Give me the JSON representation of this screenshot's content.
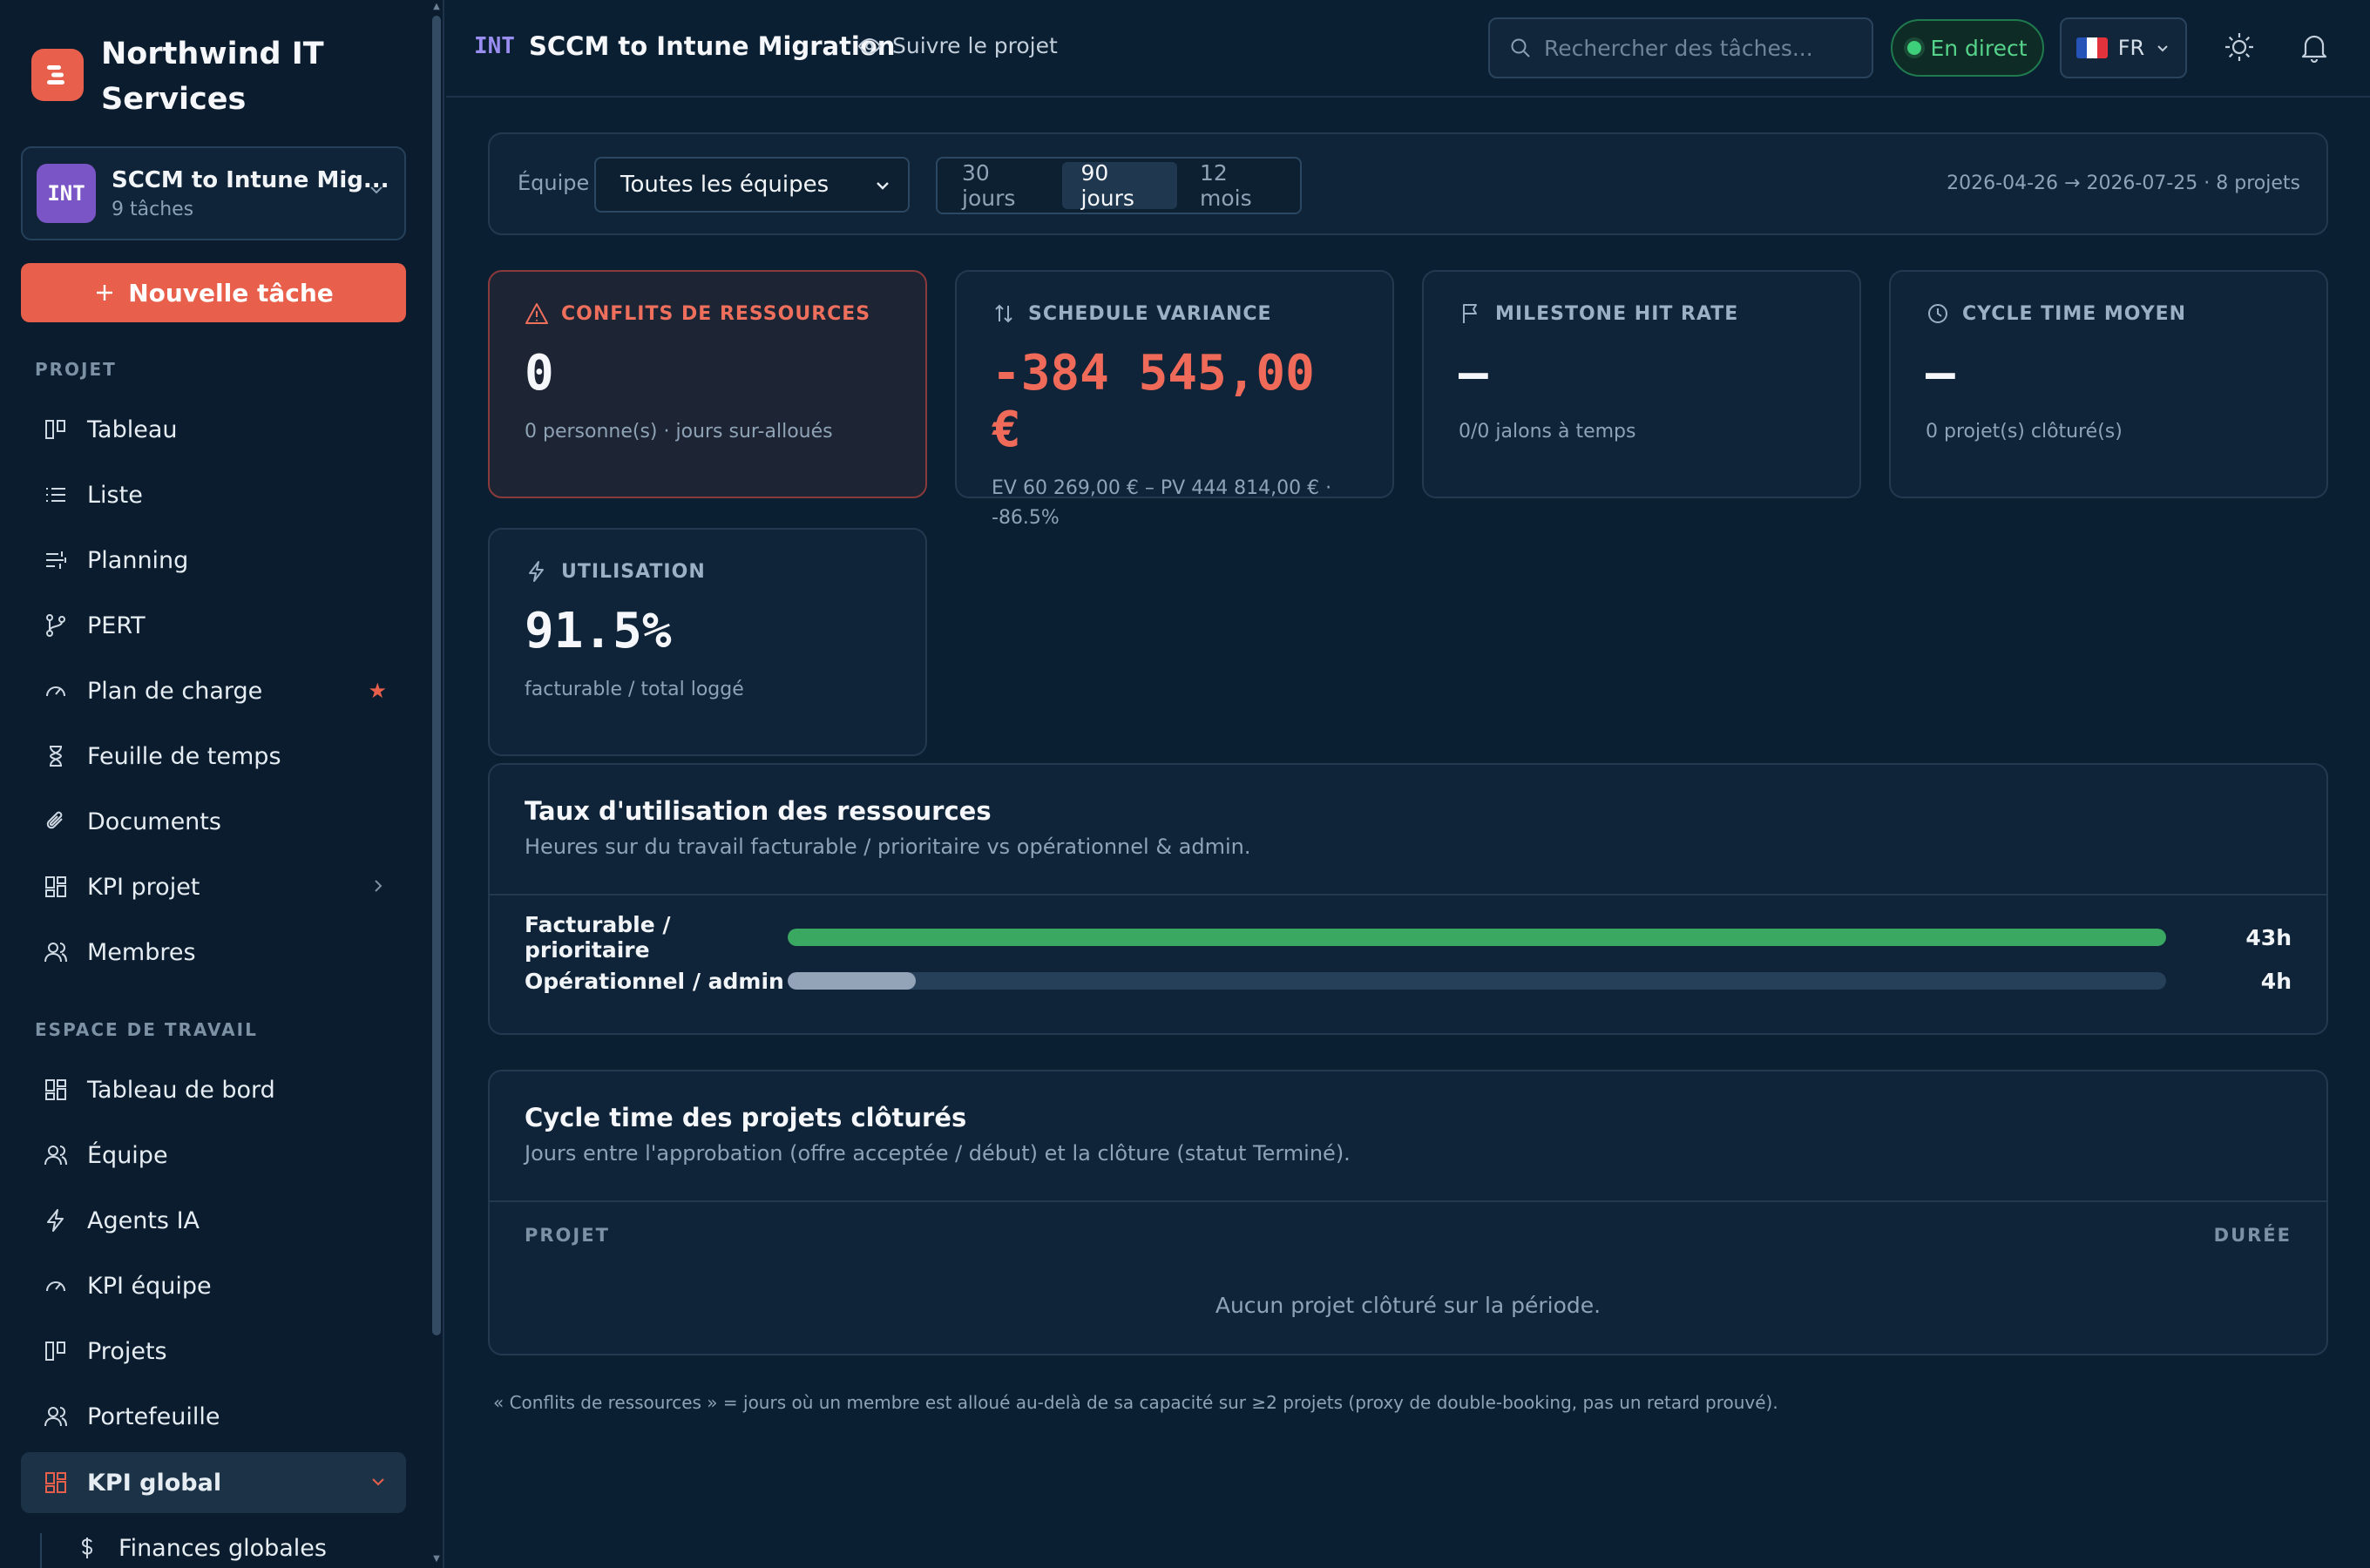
{
  "brand": {
    "name": "Northwind IT Services"
  },
  "project_selector": {
    "code": "INT",
    "name": "SCCM to Intune Mig...",
    "tasks": "9 tâches"
  },
  "new_task_label": "Nouvelle tâche",
  "sidebar": {
    "project_section": "PROJET",
    "project_items": [
      {
        "label": "Tableau",
        "icon": "kanban-icon"
      },
      {
        "label": "Liste",
        "icon": "list-icon"
      },
      {
        "label": "Planning",
        "icon": "gantt-icon"
      },
      {
        "label": "PERT",
        "icon": "branch-icon"
      },
      {
        "label": "Plan de charge",
        "icon": "gauge-icon",
        "starred": true
      },
      {
        "label": "Feuille de temps",
        "icon": "hourglass-icon"
      },
      {
        "label": "Documents",
        "icon": "paperclip-icon"
      },
      {
        "label": "KPI projet",
        "icon": "grid-icon",
        "has_submenu": true
      },
      {
        "label": "Membres",
        "icon": "users-icon"
      }
    ],
    "workspace_section": "ESPACE DE TRAVAIL",
    "workspace_items": [
      {
        "label": "Tableau de bord",
        "icon": "grid-icon"
      },
      {
        "label": "Équipe",
        "icon": "users-icon"
      },
      {
        "label": "Agents IA",
        "icon": "bolt-icon"
      },
      {
        "label": "KPI équipe",
        "icon": "gauge-icon"
      },
      {
        "label": "Projets",
        "icon": "kanban-icon"
      },
      {
        "label": "Portefeuille",
        "icon": "users-icon"
      },
      {
        "label": "KPI global",
        "icon": "grid-icon",
        "active": true
      },
      {
        "label": "Finances globales",
        "icon": "dollar-icon",
        "sub": true
      }
    ]
  },
  "topbar": {
    "code": "INT",
    "title": "SCCM to Intune Migration",
    "follow": "Suivre le projet",
    "search_placeholder": "Rechercher des tâches...",
    "live": "En direct",
    "lang": "FR"
  },
  "filters": {
    "team_label": "Équipe",
    "team_value": "Toutes les équipes",
    "periods": [
      "30 jours",
      "90 jours",
      "12 mois"
    ],
    "selected_period": "90 jours",
    "range": "2026-04-26 → 2026-07-25 · 8 projets"
  },
  "kpis": [
    {
      "title": "CONFLITS DE RESSOURCES",
      "value": "0",
      "sub": "0 personne(s) · jours sur-alloués",
      "icon": "warning-icon"
    },
    {
      "title": "SCHEDULE VARIANCE",
      "value": "-384 545,00 €",
      "sub": "EV 60 269,00 € – PV 444 814,00 € · -86.5%",
      "icon": "sort-icon"
    },
    {
      "title": "MILESTONE HIT RATE",
      "value": "—",
      "sub": "0/0 jalons à temps",
      "icon": "flag-icon"
    },
    {
      "title": "CYCLE TIME MOYEN",
      "value": "—",
      "sub": "0 projet(s) clôturé(s)",
      "icon": "clock-icon"
    },
    {
      "title": "UTILISATION",
      "value": "91.5%",
      "sub": "facturable / total loggé",
      "icon": "bolt-icon"
    }
  ],
  "utilization": {
    "title": "Taux d'utilisation des ressources",
    "subtitle": "Heures sur du travail facturable / prioritaire vs opérationnel & admin.",
    "rows": [
      {
        "label": "Facturable / prioritaire",
        "value": "43h",
        "hours": 43,
        "color": "#3aa860"
      },
      {
        "label": "Opérationnel / admin",
        "value": "4h",
        "hours": 4,
        "color": "#93a3b8"
      }
    ]
  },
  "cycle": {
    "title": "Cycle time des projets clôturés",
    "subtitle": "Jours entre l'approbation (offre acceptée / début) et la clôture (statut Terminé).",
    "col_project": "PROJET",
    "col_duration": "DURÉE",
    "empty": "Aucun projet clôturé sur la période."
  },
  "footnote": "« Conflits de ressources » = jours où un membre est alloué au-delà de sa capacité sur ≥2 projets (proxy de double-booking, pas un retard prouvé)."
}
